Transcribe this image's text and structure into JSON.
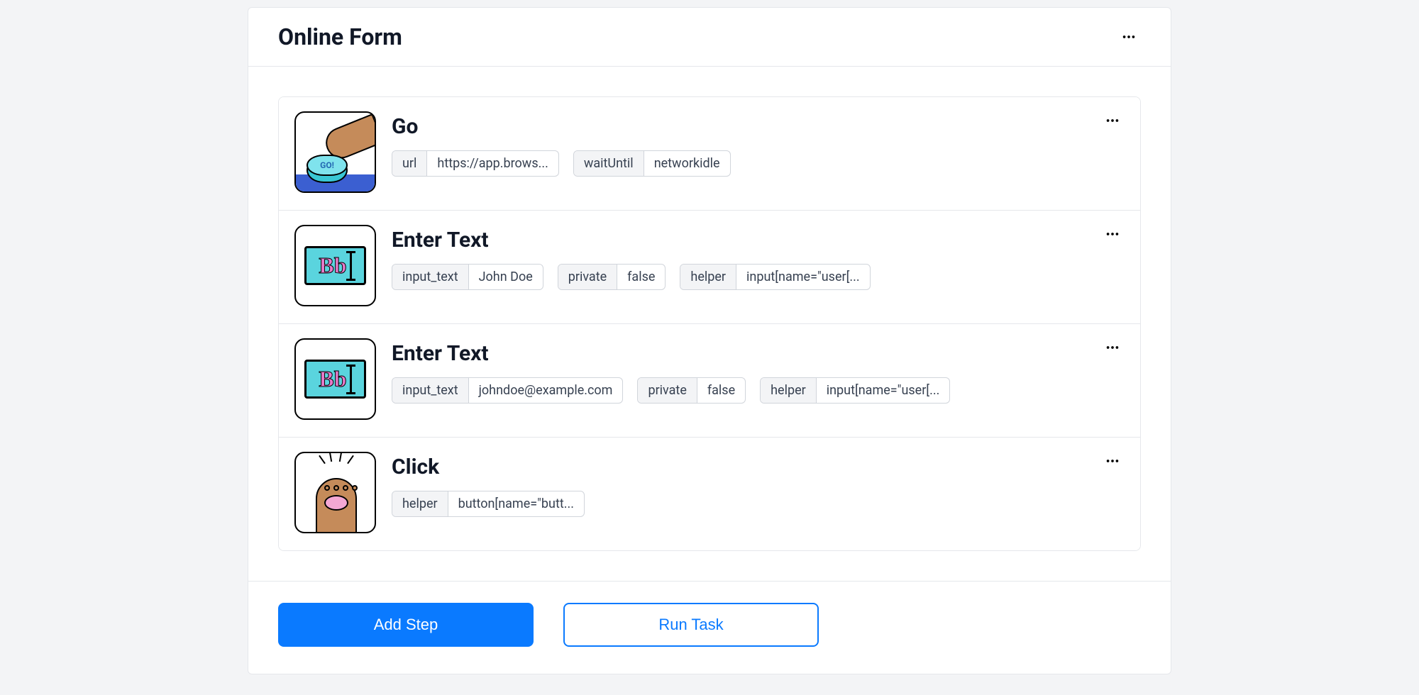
{
  "header": {
    "title": "Online Form"
  },
  "steps": [
    {
      "icon": "go",
      "title": "Go",
      "params": [
        {
          "key": "url",
          "value": "https://app.brows..."
        },
        {
          "key": "waitUntil",
          "value": "networkidle"
        }
      ]
    },
    {
      "icon": "enter-text",
      "title": "Enter Text",
      "params": [
        {
          "key": "input_text",
          "value": "John Doe"
        },
        {
          "key": "private",
          "value": "false"
        },
        {
          "key": "helper",
          "value": "input[name=\"user[..."
        }
      ]
    },
    {
      "icon": "enter-text",
      "title": "Enter Text",
      "params": [
        {
          "key": "input_text",
          "value": "johndoe@example.com"
        },
        {
          "key": "private",
          "value": "false"
        },
        {
          "key": "helper",
          "value": "input[name=\"user[..."
        }
      ]
    },
    {
      "icon": "click",
      "title": "Click",
      "params": [
        {
          "key": "helper",
          "value": "button[name=\"butt..."
        }
      ]
    }
  ],
  "footer": {
    "add_step_label": "Add Step",
    "run_task_label": "Run Task"
  },
  "icons": {
    "go_label": "GO!",
    "bb_label": "Bb"
  }
}
